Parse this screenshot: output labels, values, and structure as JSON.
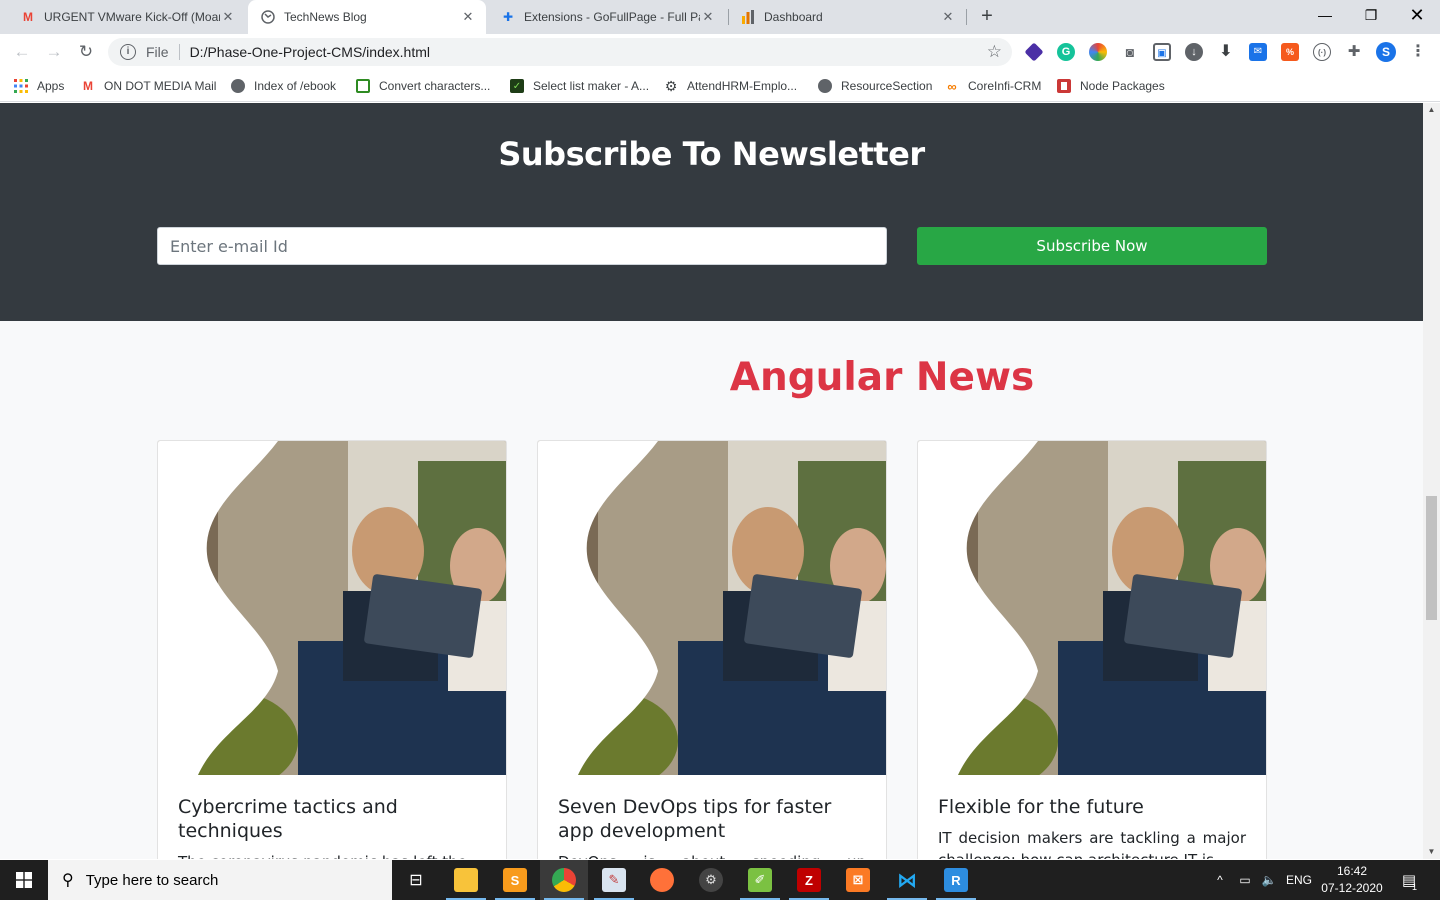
{
  "browser": {
    "tabs": [
      {
        "title": "URGENT VMware Kick-Off (Moan",
        "icon": "gmail-icon"
      },
      {
        "title": "TechNews Blog",
        "icon": "globe-icon",
        "active": true
      },
      {
        "title": "Extensions - GoFullPage - Full Pa",
        "icon": "puzzle-icon"
      },
      {
        "title": "Dashboard",
        "icon": "bar-chart-icon"
      }
    ],
    "address": {
      "scheme": "File",
      "url": "D:/Phase-One-Project-CMS/index.html"
    },
    "profile_initial": "S",
    "bookmarks": [
      {
        "label": "Apps",
        "icon": "apps-grid-icon"
      },
      {
        "label": "ON DOT MEDIA Mail",
        "icon": "gmail-icon"
      },
      {
        "label": "Index of /ebook",
        "icon": "globe-icon"
      },
      {
        "label": "Convert characters...",
        "icon": "grid-icon"
      },
      {
        "label": "Select list maker - A...",
        "icon": "checkmark-icon"
      },
      {
        "label": "AttendHRM-Emplo...",
        "icon": "gear-icon"
      },
      {
        "label": "ResourceSection",
        "icon": "globe-icon"
      },
      {
        "label": "CoreInfi-CRM",
        "icon": "link-icon"
      },
      {
        "label": "Node Packages",
        "icon": "npm-icon"
      }
    ]
  },
  "page": {
    "newsletter": {
      "heading": "Subscribe To Newsletter",
      "email_placeholder": "Enter e-mail Id",
      "button_label": "Subscribe Now"
    },
    "section_title": "Angular News",
    "cards": [
      {
        "title": "Cybercrime tactics and techniques",
        "text": "The coronavirus pandemic has left the"
      },
      {
        "title": "Seven DevOps tips for faster app development",
        "text": "DevOps is about speeding up application"
      },
      {
        "title": "Flexible for the future",
        "text": "IT decision makers are tackling a major challenge: how can architecture IT is"
      }
    ]
  },
  "taskbar": {
    "search_placeholder": "Type here to search",
    "language": "ENG",
    "time": "16:42",
    "date": "07-12-2020",
    "notification_count": "1"
  },
  "colors": {
    "newsletter_bg": "#343a40",
    "subscribe_green": "#28a745",
    "section_title_red": "#dc3545"
  }
}
